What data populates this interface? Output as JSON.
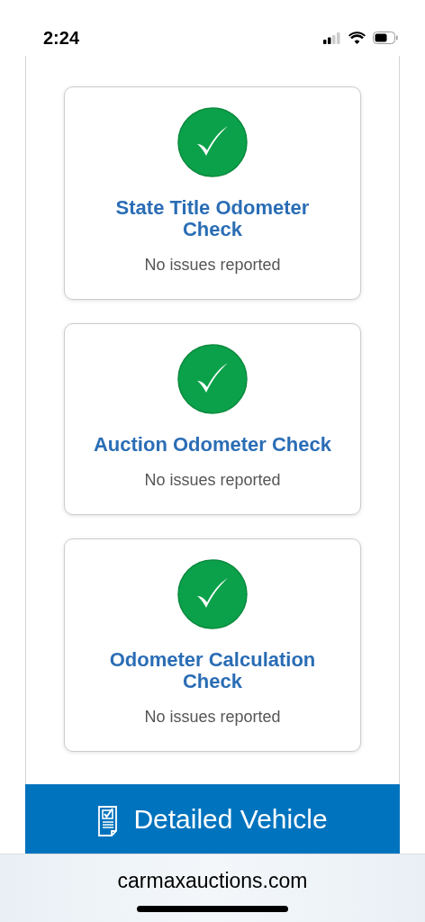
{
  "status_bar": {
    "time": "2:24"
  },
  "checks": [
    {
      "title": "State Title Odometer Check",
      "status": "No issues reported",
      "passed": true
    },
    {
      "title": "Auction Odometer Check",
      "status": "No issues reported",
      "passed": true
    },
    {
      "title": "Odometer Calculation Check",
      "status": "No issues reported",
      "passed": true
    }
  ],
  "section_header": {
    "title": "Detailed Vehicle"
  },
  "browser_bar": {
    "url": "carmaxauctions.com"
  }
}
